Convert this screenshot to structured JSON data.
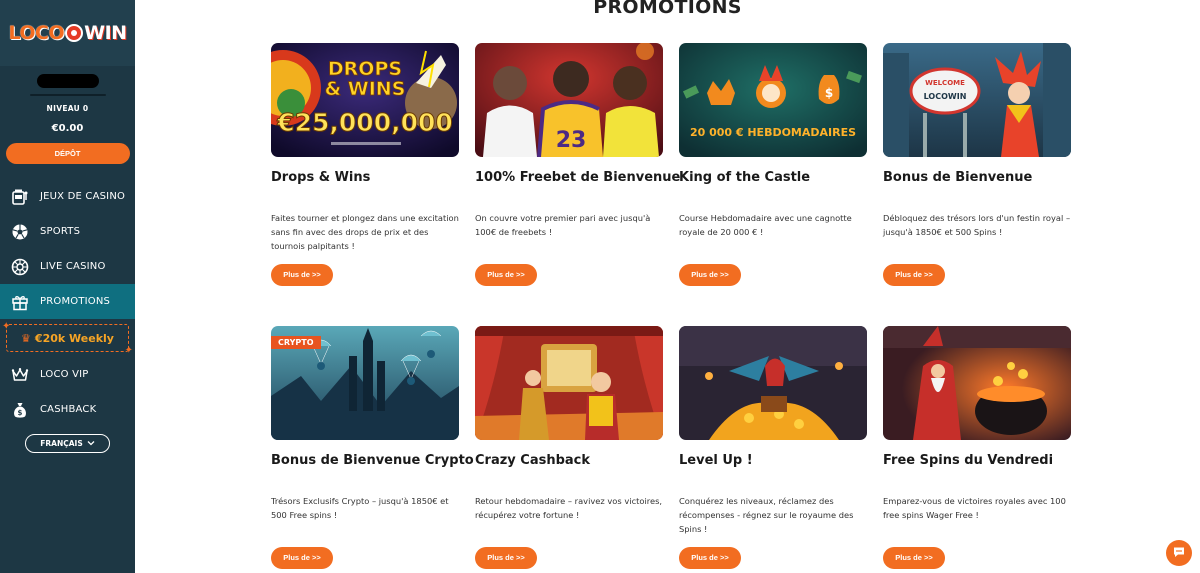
{
  "brand": {
    "logo_part1": "LOCO",
    "logo_part2": "WIN"
  },
  "user": {
    "level": "NIVEAU 0",
    "balance": "€0.00"
  },
  "sidebar": {
    "deposit_label": "DÉPÔT",
    "items": [
      {
        "label": "JEUX DE CASINO",
        "icon": "slot-machine-icon"
      },
      {
        "label": "SPORTS",
        "icon": "soccer-ball-icon"
      },
      {
        "label": "LIVE CASINO",
        "icon": "roulette-icon"
      },
      {
        "label": "PROMOTIONS",
        "icon": "gift-icon",
        "active": true
      },
      {
        "label": "LOCO VIP",
        "icon": "crown-icon"
      },
      {
        "label": "CASHBACK",
        "icon": "money-bag-icon"
      }
    ],
    "weekly_label": "€20k Weekly",
    "language_label": "FRANÇAIS"
  },
  "page": {
    "title": "PROMOTIONS"
  },
  "promotions": [
    {
      "title": "Drops & Wins",
      "description": "Faites tourner et plongez dans une excitation sans fin avec des drops de prix et des tournois palpitants !",
      "button": "Plus de >>",
      "image_text": {
        "headline": "DROPS",
        "headline2": "& WINS",
        "amount": "€25,000,000"
      }
    },
    {
      "title": "100% Freebet de Bienvenue",
      "description": "On couvre votre premier pari avec jusqu'à 100€ de freebets !",
      "button": "Plus de >>",
      "image_text": {
        "jersey": "23"
      }
    },
    {
      "title": "King of the Castle",
      "description": "Course Hebdomadaire avec une cagnotte royale de 20 000 € !",
      "button": "Plus de >>",
      "image_text": {
        "banner": "20 000 € HEBDOMADAIRES"
      }
    },
    {
      "title": "Bonus de Bienvenue",
      "description": "Débloquez des trésors lors d'un festin royal – jusqu'à 1850€ et 500 Spins !",
      "button": "Plus de >>",
      "image_text": {
        "sign_top": "WELCOME",
        "sign_bottom": "LOCOWIN"
      }
    },
    {
      "title": "Bonus de Bienvenue Crypto",
      "description": "Trésors Exclusifs Crypto – jusqu'à 1850€ et 500 Free spins !",
      "button": "Plus de >>",
      "image_text": {
        "badge": "CRYPTO"
      }
    },
    {
      "title": "Crazy Cashback",
      "description": "Retour hebdomadaire – ravivez vos victoires, récupérez votre fortune !",
      "button": "Plus de >>"
    },
    {
      "title": "Level Up !",
      "description": "Conquérez les niveaux, réclamez des récompenses - régnez sur le royaume des Spins !",
      "button": "Plus de >>"
    },
    {
      "title": "Free Spins du Vendredi",
      "description": "Emparez-vous de victoires royales avec 100 free spins Wager Free !",
      "button": "Plus de >>"
    }
  ],
  "colors": {
    "accent": "#f26d21",
    "sidebar_bg": "#1d3744",
    "active_nav": "#0f6f80"
  }
}
